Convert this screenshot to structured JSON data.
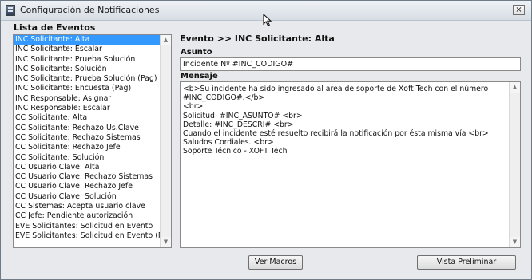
{
  "window": {
    "title": "Configuración de Notificaciones",
    "close_label": "×"
  },
  "event_list": {
    "heading": "Lista de Eventos",
    "selected_index": 0,
    "items": [
      "INC Solicitante: Alta",
      "INC Solicitante: Escalar",
      "INC Solicitante: Prueba Solución",
      "INC Solicitante: Solución",
      "INC Solicitante: Prueba Solución (Pag)",
      "INC Solicitante: Encuesta (Pag)",
      "INC Responsable: Asignar",
      "INC Responsable: Escalar",
      "CC Solicitante: Alta",
      "CC Solicitante: Rechazo Us.Clave",
      "CC Solicitante: Rechazo Sistemas",
      "CC Solicitante: Rechazo Jefe",
      "CC Solicitante: Solución",
      "CC Usuario Clave: Alta",
      "CC Usuario Clave: Rechazo Sistemas",
      "CC Usuario Clave: Rechazo Jefe",
      "CC Usuario Clave: Solución",
      "CC Sistemas: Acepta usuario clave",
      "CC Jefe: Pendiente autorización",
      "EVE Solicitantes: Solicitud en Evento",
      "EVE Solicitantes: Solicitud en Evento (Pag)"
    ]
  },
  "detail": {
    "event_heading": "Evento >> INC Solicitante: Alta",
    "subject_label": "Asunto",
    "subject_value": "Incidente Nº #INC_CODIGO#",
    "message_label": "Mensaje",
    "message_lines": [
      "<b>Su incidente ha sido ingresado al área de soporte de Xoft Tech con el número",
      "#INC_CODIGO#.</b>",
      "<br>",
      "Solicitud: #INC_ASUNTO#  <br>",
      "Detalle: #INC_DESCRI# <br>",
      "Cuando el incidente esté resuelto recibirá la notificación por ésta misma vía <br>",
      "Saludos Cordiales. <br>",
      "Soporte Técnico - XOFT Tech"
    ]
  },
  "buttons": {
    "macros": "Ver Macros",
    "preview": "Vista Preliminar"
  },
  "icons": {
    "app": "notification-app-icon",
    "close": "close-icon",
    "cursor": "mouse-cursor-icon",
    "scroll_up": "scroll-up-arrow-icon",
    "scroll_down": "scroll-down-arrow-icon"
  },
  "colors": {
    "selection": "#3399ff"
  }
}
